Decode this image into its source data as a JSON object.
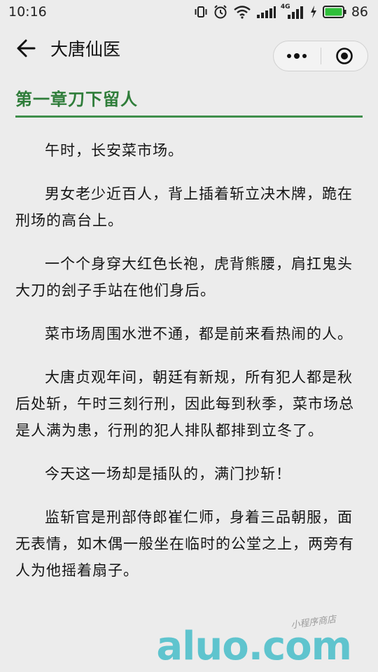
{
  "status": {
    "time": "10:16",
    "network": "4G",
    "battery": "86",
    "battery_level": 0.86
  },
  "nav": {
    "title": "大唐仙医"
  },
  "chapter": {
    "title": "第一章刀下留人",
    "paragraphs": [
      "午时，长安菜市场。",
      "男女老少近百人，背上插着斩立决木牌，跪在刑场的高台上。",
      "一个个身穿大红色长袍，虎背熊腰，肩扛鬼头大刀的刽子手站在他们身后。",
      "菜市场周围水泄不通，都是前来看热闹的人。",
      "大唐贞观年间，朝廷有新规，所有犯人都是秋后处斩，午时三刻行刑，因此每到秋季，菜市场总是人满为患，行刑的犯人排队都排到立冬了。",
      "今天这一场却是插队的，满门抄斩！",
      "监斩官是刑部侍郎崔仁师，身着三品朝服，面无表情，如木偶一般坐在临时的公堂之上，两旁有人为他摇着扇子。"
    ]
  },
  "watermark": {
    "main": "aluo.com",
    "small": "小程序商店"
  },
  "colors": {
    "accent": "#2f7d3a",
    "battery": "#2fbf3a",
    "watermark": "#30b7c4"
  }
}
